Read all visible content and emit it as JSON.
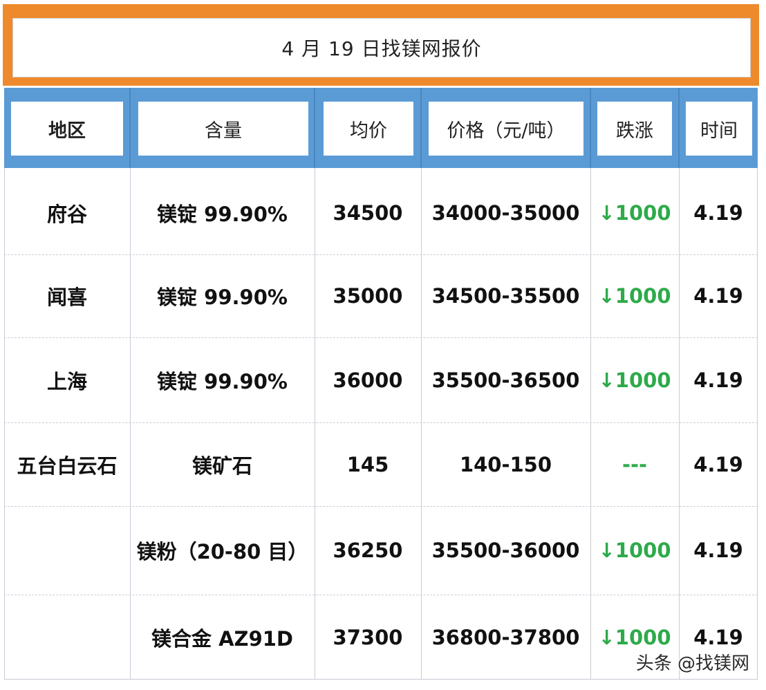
{
  "title": "4 月 19 日找镁网报价",
  "headers": [
    "地区",
    "含量",
    "均价",
    "价格（元/吨）",
    "跌涨",
    "时间"
  ],
  "rows": [
    {
      "region": "府谷",
      "content": "镁锭 99.90%",
      "avg": "34500",
      "price": "34000-35000",
      "change": "↓1000",
      "time": "4.19"
    },
    {
      "region": "闻喜",
      "content": "镁锭 99.90%",
      "avg": "35000",
      "price": "34500-35500",
      "change": "↓1000",
      "time": "4.19"
    },
    {
      "region": "上海",
      "content": "镁锭 99.90%",
      "avg": "36000",
      "price": "35500-36500",
      "change": "↓1000",
      "time": "4.19"
    },
    {
      "region": "五台白云石",
      "content": "镁矿石",
      "avg": "145",
      "price": "140-150",
      "change": "---",
      "time": "4.19"
    },
    {
      "region": "",
      "content": "镁粉（20-80 目）",
      "avg": "36250",
      "price": "35500-36000",
      "change": "↓1000",
      "time": "4.19"
    },
    {
      "region": "",
      "content": "镁合金 AZ91D",
      "avg": "37300",
      "price": "36800-37800",
      "change": "↓1000",
      "time": "4.19"
    }
  ],
  "watermark": "头条 @找镁网",
  "colors": {
    "title_band": "#ee8a2c",
    "header_band": "#5b9bd5",
    "change_down": "#2eaa4a"
  }
}
